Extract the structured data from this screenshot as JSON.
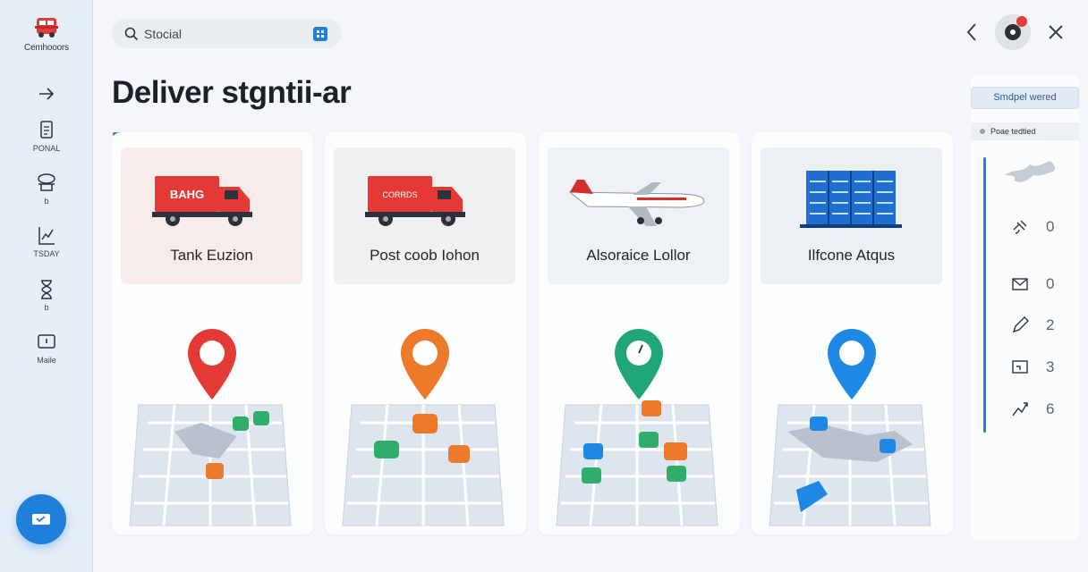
{
  "app": {
    "brand_name": "Cemhooors"
  },
  "sidebar": {
    "items": [
      {
        "label": "",
        "icon": "arrow-right-icon"
      },
      {
        "label": "PONAL",
        "icon": "document-icon"
      },
      {
        "label": "b",
        "icon": "network-icon"
      },
      {
        "label": "TSDAY",
        "icon": "chart-icon"
      },
      {
        "label": "b",
        "icon": "hourglass-icon"
      },
      {
        "label": "Maile",
        "icon": "inbox-icon"
      }
    ],
    "fab_icon": "ticket-icon"
  },
  "search": {
    "placeholder": "Stocial"
  },
  "header": {
    "title": "Deliver stgntii-ar"
  },
  "cards": [
    {
      "label": "Tank Euzion",
      "badge": "BAHG",
      "icon": "truck-icon",
      "head_bg": "#f7ece9",
      "pin_color": "#e53935"
    },
    {
      "label": "Post coob Iohon",
      "badge": "CORRDS",
      "icon": "truck-icon",
      "head_bg": "#f0f0f0",
      "pin_color": "#ec7a2a"
    },
    {
      "label": "Alsoraice Lollor",
      "badge": "",
      "icon": "airplane-icon",
      "head_bg": "#eef2f7",
      "pin_color": "#1ea67a"
    },
    {
      "label": "Ilfcone Atqus",
      "badge": "",
      "icon": "server-icon",
      "head_bg": "#eceff3",
      "pin_color": "#1e88e5"
    }
  ],
  "panel": {
    "button_label": "Smdpel wered",
    "status_label": "Poae tedtied",
    "stats": [
      {
        "icon": "satellite-icon",
        "value": "0"
      },
      {
        "icon": "mail-icon",
        "value": "0"
      },
      {
        "icon": "pen-icon",
        "value": "2"
      },
      {
        "icon": "screen-icon",
        "value": "3"
      },
      {
        "icon": "route-icon",
        "value": "6"
      }
    ]
  },
  "colors": {
    "accent": "#1f80dc",
    "alert": "#e33a3a"
  }
}
